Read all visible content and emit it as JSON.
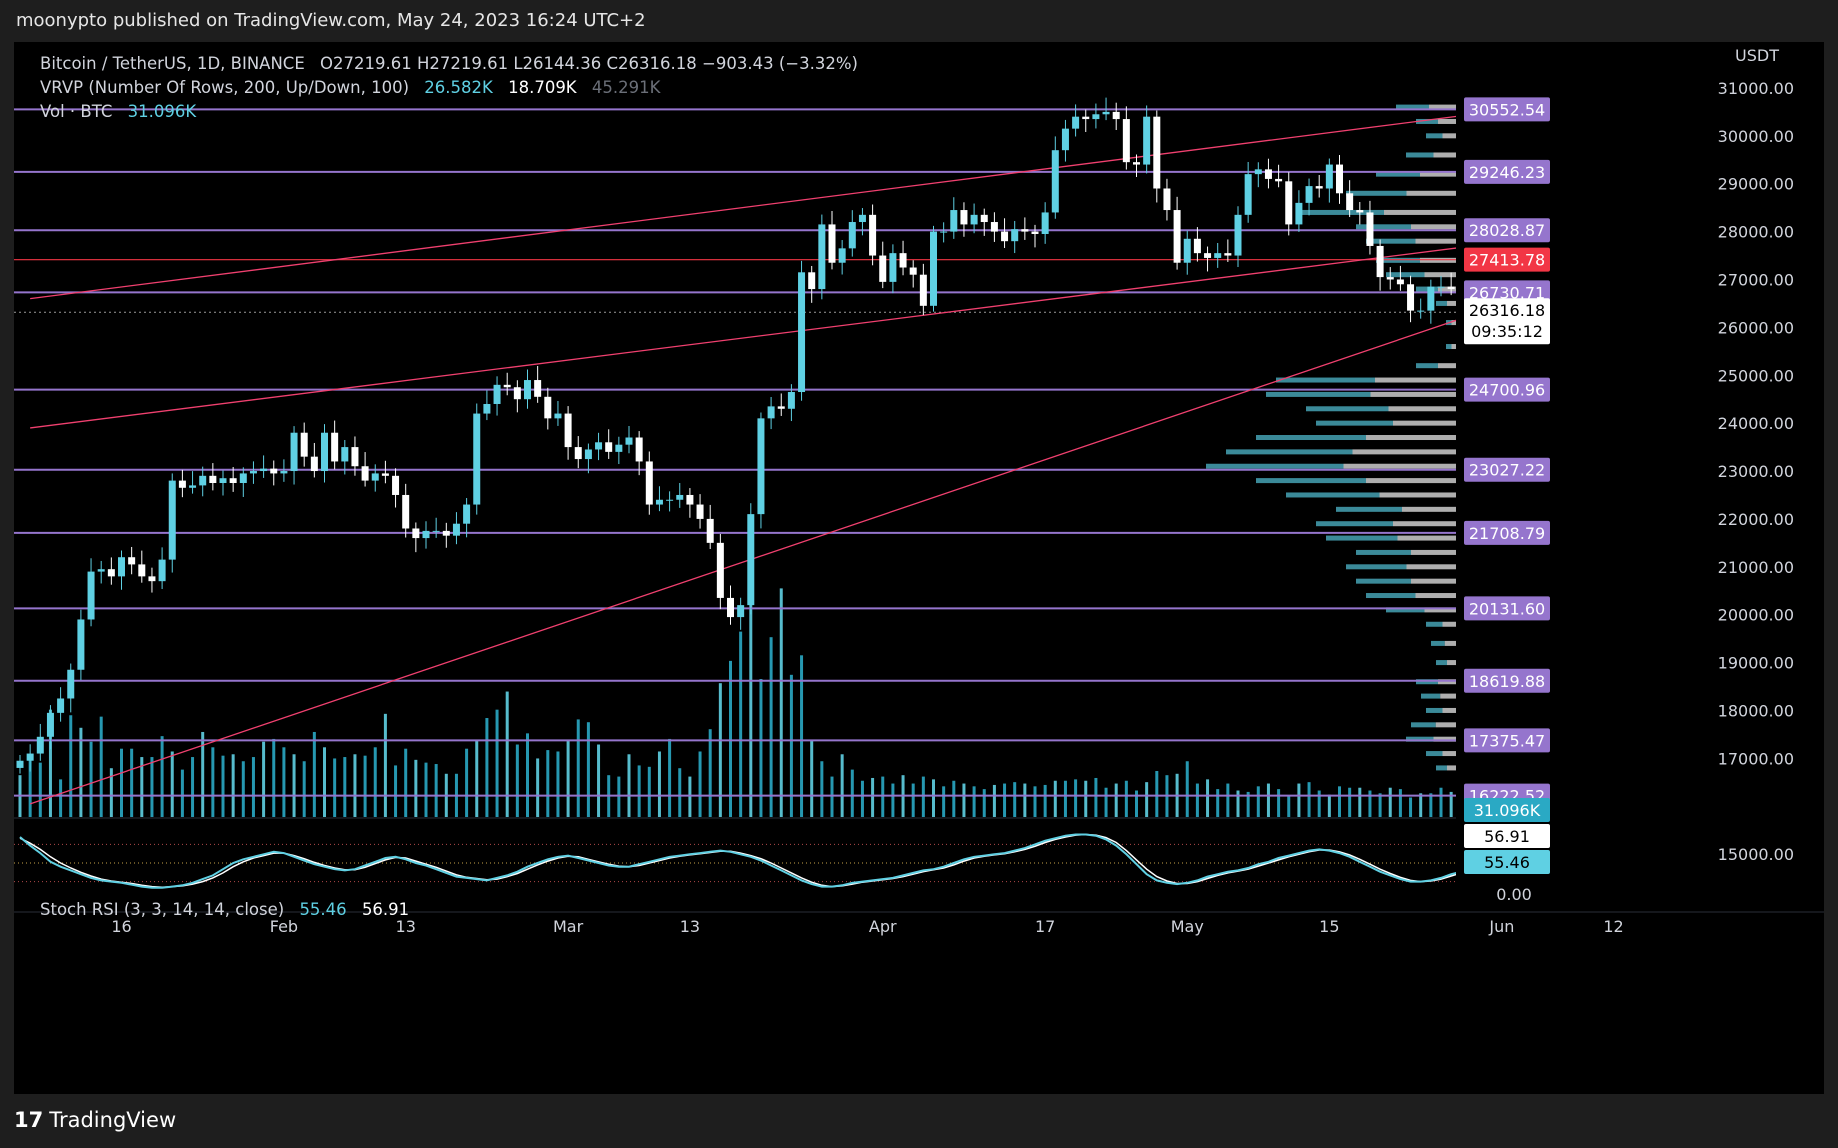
{
  "header": {
    "published": "moonypto published on TradingView.com, May 24, 2023 16:24 UTC+2"
  },
  "legend": {
    "symbol": "Bitcoin / TetherUS, 1D, BINANCE",
    "ohlc": "O27219.61  H27219.61  L26144.36  C26316.18  −903.43 (−3.32%)",
    "vrvp_label": "VRVP (Number Of Rows, 200, Up/Down, 100)",
    "vrvp_up": "26.582K",
    "vrvp_down": "18.709K",
    "vrvp_total": "45.291K",
    "vol_label": "Vol · BTC",
    "vol_value": "31.096K",
    "stoch_label": "Stoch RSI (3, 3, 14, 14, close)",
    "stoch_k": "55.46",
    "stoch_d": "56.91"
  },
  "footer": {
    "brand": "TradingView"
  },
  "colors": {
    "up": "#5fd0e3",
    "down": "#ffffff",
    "level": "#9575cd",
    "channel": "#f0406f",
    "red_level": "#f23645"
  },
  "chart_data": {
    "type": "candlestick",
    "currency": "USDT",
    "ylim": [
      14000,
      31500
    ],
    "price_ticks": [
      15000,
      17000,
      18000,
      19000,
      20000,
      21000,
      22000,
      23000,
      24000,
      25000,
      26000,
      27000,
      28000,
      29000,
      30000,
      31000
    ],
    "price_tick_labels": [
      "15000.00",
      "17000.00",
      "18000.00",
      "19000.00",
      "20000.00",
      "21000.00",
      "22000.00",
      "23000.00",
      "24000.00",
      "25000.00",
      "26000.00",
      "27000.00",
      "28000.00",
      "29000.00",
      "30000.00",
      "31000.00"
    ],
    "x_tick_labels": [
      {
        "label": "16",
        "date": "2023-01-16"
      },
      {
        "label": "Feb",
        "date": "2023-02-01"
      },
      {
        "label": "13",
        "date": "2023-02-13"
      },
      {
        "label": "Mar",
        "date": "2023-03-01"
      },
      {
        "label": "13",
        "date": "2023-03-13"
      },
      {
        "label": "Apr",
        "date": "2023-04-01"
      },
      {
        "label": "17",
        "date": "2023-04-17"
      },
      {
        "label": "May",
        "date": "2023-05-01"
      },
      {
        "label": "15",
        "date": "2023-05-15"
      },
      {
        "label": "Jun",
        "date": "2023-06-01"
      },
      {
        "label": "12",
        "date": "2023-06-12"
      }
    ],
    "horizontal_levels": [
      {
        "price": 30552.54,
        "label": "30552.54"
      },
      {
        "price": 29246.23,
        "label": "29246.23"
      },
      {
        "price": 28028.87,
        "label": "28028.87"
      },
      {
        "price": 27413.78,
        "label": "27413.78",
        "red": true
      },
      {
        "price": 26730.71,
        "label": "26730.71"
      },
      {
        "price": 24700.96,
        "label": "24700.96"
      },
      {
        "price": 23027.22,
        "label": "23027.22"
      },
      {
        "price": 21708.79,
        "label": "21708.79"
      },
      {
        "price": 20131.6,
        "label": "20131.60"
      },
      {
        "price": 18619.88,
        "label": "18619.88"
      },
      {
        "price": 17375.47,
        "label": "17375.47"
      },
      {
        "price": 16222.52,
        "label": "16222.52"
      }
    ],
    "last_price": {
      "price": 26316.18,
      "label": "26316.18",
      "countdown": "09:35:12"
    },
    "channel_lines": [
      {
        "from": [
          "2023-01-07",
          26600
        ],
        "to": [
          "2023-05-31",
          30500
        ]
      },
      {
        "from": [
          "2023-01-07",
          23900
        ],
        "to": [
          "2023-05-31",
          27750
        ]
      },
      {
        "from": [
          "2023-01-07",
          16050
        ],
        "to": [
          "2023-05-31",
          26400
        ]
      }
    ],
    "closes": [
      16950,
      17100,
      17450,
      17950,
      18250,
      18850,
      19900,
      20900,
      20950,
      20800,
      21200,
      21050,
      20800,
      20700,
      21150,
      22800,
      22650,
      22700,
      22900,
      22750,
      22850,
      22750,
      22950,
      23000,
      23050,
      22950,
      23000,
      23800,
      23300,
      23000,
      23800,
      23200,
      23500,
      23100,
      22800,
      22950,
      22900,
      22500,
      21800,
      21600,
      21750,
      21750,
      21650,
      21900,
      22300,
      24200,
      24400,
      24800,
      24750,
      24500,
      24900,
      24550,
      24100,
      24200,
      23500,
      23250,
      23450,
      23600,
      23400,
      23550,
      23700,
      23200,
      22300,
      22400,
      22400,
      22500,
      22300,
      22000,
      21500,
      20350,
      19950,
      20200,
      22100,
      24100,
      24350,
      24300,
      24650,
      27150,
      26800,
      28150,
      27350,
      27650,
      28200,
      28350,
      27500,
      26950,
      27550,
      27250,
      27100,
      26450,
      28000,
      28000,
      28450,
      28150,
      28350,
      28200,
      28000,
      27800,
      28050,
      28000,
      27950,
      28400,
      29700,
      30150,
      30400,
      30350,
      30450,
      30500,
      30350,
      29450,
      29400,
      30400,
      28900,
      28450,
      27350,
      27850,
      27550,
      27450,
      27550,
      27500,
      28350,
      29200,
      29300,
      29100,
      29050,
      28150,
      28600,
      28950,
      28900,
      29400,
      28800,
      28450,
      28400,
      27700,
      27050,
      27000,
      26900,
      26350,
      26350,
      26850,
      26850,
      26800,
      26800,
      26950,
      26950,
      27050,
      27200,
      26850,
      26950,
      26850,
      26700,
      27300,
      26316.18
    ],
    "volume": [
      300,
      430,
      390,
      770,
      270,
      730,
      640,
      540,
      720,
      350,
      490,
      490,
      430,
      430,
      580,
      470,
      340,
      430,
      610,
      500,
      440,
      450,
      400,
      430,
      540,
      560,
      500,
      450,
      400,
      610,
      500,
      420,
      430,
      450,
      440,
      500,
      740,
      370,
      490,
      410,
      390,
      380,
      310,
      310,
      490,
      550,
      710,
      770,
      900,
      520,
      600,
      420,
      480,
      470,
      550,
      700,
      680,
      520,
      300,
      290,
      450,
      370,
      360,
      470,
      560,
      350,
      290,
      470,
      630,
      960,
      1120,
      1330,
      1650,
      990,
      1290,
      1640,
      1020,
      1160,
      550,
      400,
      290,
      450,
      340,
      260,
      280,
      290,
      240,
      300,
      240,
      290,
      270,
      220,
      260,
      240,
      220,
      200,
      230,
      240,
      250,
      240,
      220,
      230,
      260,
      260,
      270,
      260,
      280,
      210,
      240,
      260,
      190,
      250,
      330,
      300,
      310,
      400,
      240,
      270,
      200,
      240,
      190,
      180,
      220,
      240,
      200,
      150,
      240,
      250,
      190,
      160,
      220,
      210,
      210,
      190,
      170,
      210,
      200,
      140,
      170,
      170,
      210,
      180,
      160,
      120,
      180,
      150,
      160,
      190,
      220,
      120,
      170,
      200,
      300
    ],
    "stoch_ylim": [
      0,
      100
    ],
    "stoch_tick_labels": [
      "0.00"
    ],
    "stoch_levels": [
      80,
      50,
      20
    ],
    "stoch_k_series": [
      92,
      78,
      66,
      52,
      44,
      38,
      32,
      26,
      22,
      20,
      18,
      15,
      12,
      10,
      10,
      12,
      14,
      18,
      24,
      30,
      40,
      50,
      56,
      60,
      64,
      68,
      66,
      60,
      54,
      48,
      44,
      40,
      38,
      40,
      46,
      52,
      58,
      60,
      56,
      50,
      46,
      40,
      34,
      28,
      26,
      24,
      22,
      26,
      30,
      36,
      44,
      50,
      56,
      60,
      62,
      58,
      54,
      50,
      46,
      44,
      44,
      48,
      52,
      56,
      60,
      62,
      64,
      66,
      68,
      70,
      68,
      64,
      60,
      54,
      46,
      38,
      30,
      22,
      16,
      12,
      12,
      14,
      18,
      20,
      22,
      24,
      26,
      30,
      34,
      38,
      40,
      44,
      50,
      56,
      60,
      62,
      64,
      66,
      70,
      74,
      80,
      86,
      90,
      94,
      96,
      96,
      94,
      88,
      78,
      64,
      48,
      32,
      22,
      18,
      16,
      18,
      22,
      28,
      32,
      36,
      38,
      42,
      48,
      52,
      58,
      62,
      66,
      70,
      72,
      70,
      66,
      60,
      52,
      44,
      36,
      30,
      24,
      20,
      20,
      22,
      26,
      32,
      36,
      40,
      44,
      48,
      52,
      56,
      60,
      64,
      58
    ],
    "stoch_d_series": [
      90,
      82,
      72,
      60,
      50,
      42,
      35,
      29,
      24,
      21,
      19,
      17,
      14,
      12,
      11,
      12,
      13,
      16,
      20,
      26,
      34,
      44,
      52,
      58,
      62,
      66,
      66,
      62,
      57,
      51,
      46,
      42,
      39,
      39,
      43,
      49,
      55,
      59,
      58,
      53,
      48,
      43,
      37,
      31,
      27,
      25,
      23,
      24,
      28,
      33,
      40,
      47,
      53,
      58,
      61,
      60,
      56,
      52,
      48,
      45,
      44,
      46,
      50,
      54,
      58,
      61,
      63,
      65,
      67,
      69,
      69,
      66,
      62,
      57,
      50,
      42,
      34,
      26,
      19,
      14,
      12,
      13,
      16,
      19,
      21,
      23,
      25,
      28,
      32,
      36,
      39,
      42,
      47,
      53,
      58,
      61,
      63,
      65,
      68,
      72,
      77,
      83,
      88,
      92,
      95,
      96,
      95,
      91,
      83,
      70,
      55,
      40,
      28,
      21,
      17,
      17,
      20,
      25,
      30,
      34,
      37,
      40,
      45,
      50,
      55,
      60,
      64,
      68,
      71,
      71,
      68,
      63,
      56,
      48,
      40,
      33,
      27,
      22,
      20,
      21,
      24,
      29,
      34,
      38,
      42,
      46,
      50,
      54,
      58,
      61,
      60
    ]
  }
}
